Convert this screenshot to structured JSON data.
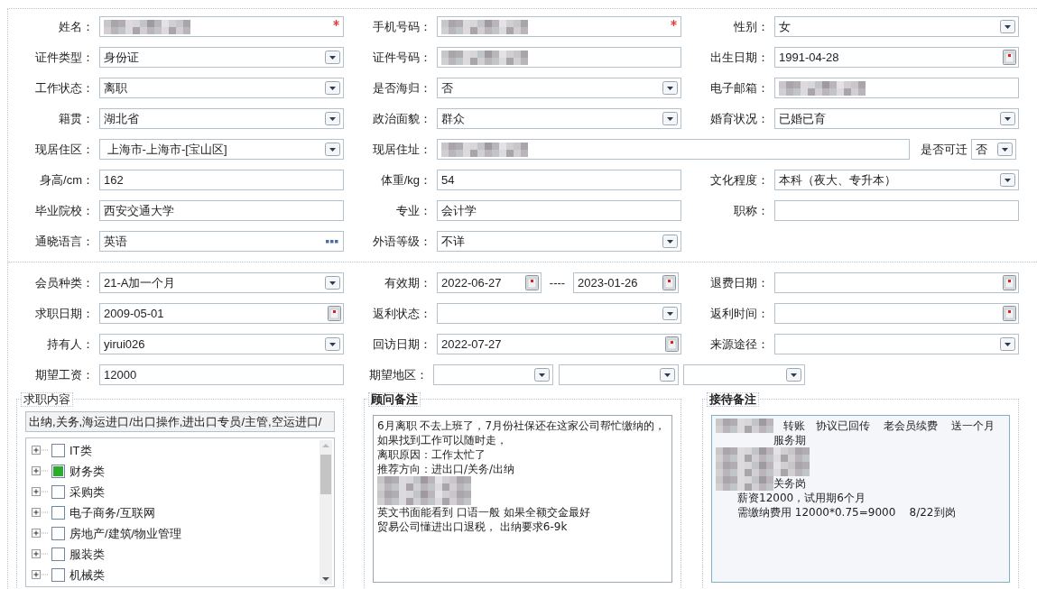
{
  "personal_fields": [
    {
      "label": "姓名：",
      "kind": "text",
      "redacted": true,
      "required": true
    },
    {
      "label": "手机号码：",
      "kind": "text",
      "redacted": true,
      "required": true
    },
    {
      "label": "性别：",
      "kind": "select",
      "value": "女"
    },
    {
      "label": "证件类型：",
      "kind": "select",
      "value": "身份证"
    },
    {
      "label": "证件号码：",
      "kind": "text",
      "redacted": true
    },
    {
      "label": "出生日期：",
      "kind": "date",
      "value": "1991-04-28"
    },
    {
      "label": "工作状态：",
      "kind": "select",
      "value": "离职"
    },
    {
      "label": "是否海归：",
      "kind": "select",
      "value": "否"
    },
    {
      "label": "电子邮箱：",
      "kind": "text",
      "redacted": true
    },
    {
      "label": "籍贯：",
      "kind": "select",
      "value": "湖北省"
    },
    {
      "label": "政治面貌：",
      "kind": "select",
      "value": "群众"
    },
    {
      "label": "婚育状况：",
      "kind": "select",
      "value": "已婚已育"
    },
    {
      "label": "现居住区：",
      "kind": "select",
      "value": " 上海市-上海市-[宝山区]"
    },
    {
      "label": "现居住址：",
      "kind": "text",
      "redacted": true,
      "side_select": {
        "label": "是否可迁",
        "value": "否"
      }
    },
    {
      "label": "身高/cm：",
      "kind": "text",
      "value": "162"
    },
    {
      "label": "体重/kg：",
      "kind": "text",
      "value": "54"
    },
    {
      "label": "文化程度：",
      "kind": "select",
      "value": "本科（夜大、专升本）"
    },
    {
      "label": "毕业院校：",
      "kind": "text",
      "value": "西安交通大学"
    },
    {
      "label": "专业：",
      "kind": "text",
      "value": "会计学"
    },
    {
      "label": "职称：",
      "kind": "text"
    },
    {
      "label": "通晓语言：",
      "kind": "picker",
      "value": "英语"
    },
    {
      "label": "外语等级：",
      "kind": "select",
      "value": "不详"
    }
  ],
  "membership_fields": [
    {
      "label": "会员种类：",
      "kind": "select",
      "value": "21-A加一个月"
    },
    {
      "label": "有效期：",
      "kind": "date_range",
      "from": "2022-06-27",
      "separator": "----",
      "to": "2023-01-26"
    },
    {
      "label": "退费日期：",
      "kind": "date"
    },
    {
      "label": "求职日期：",
      "kind": "date",
      "value": "2009-05-01"
    },
    {
      "label": "返利状态：",
      "kind": "select"
    },
    {
      "label": "返利时间：",
      "kind": "date"
    },
    {
      "label": "持有人：",
      "kind": "select",
      "value": "yirui026"
    },
    {
      "label": "回访日期：",
      "kind": "date",
      "value": "2022-07-27"
    },
    {
      "label": "来源途径：",
      "kind": "select"
    },
    {
      "label": "期望工资：",
      "kind": "text",
      "value": "12000"
    },
    {
      "label": "期望地区：",
      "kind": "region"
    }
  ],
  "job_content": {
    "legend": "求职内容",
    "value": "出纳,关务,海运进口/出口操作,进出口专员/主管,空运进口/",
    "categories": [
      {
        "label": "IT类",
        "checked": false
      },
      {
        "label": "财务类",
        "checked": true
      },
      {
        "label": "采购类",
        "checked": false
      },
      {
        "label": "电子商务/互联网",
        "checked": false
      },
      {
        "label": "房地产/建筑/物业管理",
        "checked": false
      },
      {
        "label": "服装类",
        "checked": false
      },
      {
        "label": "机械类",
        "checked": false
      }
    ]
  },
  "consultant_notes": {
    "legend": "顾问备注",
    "lines": [
      {
        "text": "6月离职 不去上班了，7月份社保还在这家公司帮忙缴纳的，如果找到工作可以随时走，"
      },
      {
        "text": "离职原因：工作太忙了"
      },
      {
        "text": "推荐方向：进出口/关务/出纳"
      },
      {
        "redacted": true
      },
      {
        "redacted": true
      },
      {
        "text": "英文书面能看到 口语一般 如果全额交金最好"
      },
      {
        "text": "贸易公司懂进出口退税， 出纳要求6-9k"
      }
    ]
  },
  "reception_notes": {
    "legend": "接待备注",
    "lines": [
      {
        "redacted_prefix": true,
        "text": "   转账   协议已回传    老会员续费    送一个月服务期"
      },
      {
        "redacted": true
      },
      {
        "redacted": true
      },
      {
        "redacted_prefix": true,
        "text": "关务岗"
      },
      {
        "indented": true,
        "text": "薪资12000，试用期6个月"
      },
      {
        "indented": true,
        "text": "需缴纳费用 12000*0.75=9000    8/22到岗"
      }
    ]
  }
}
